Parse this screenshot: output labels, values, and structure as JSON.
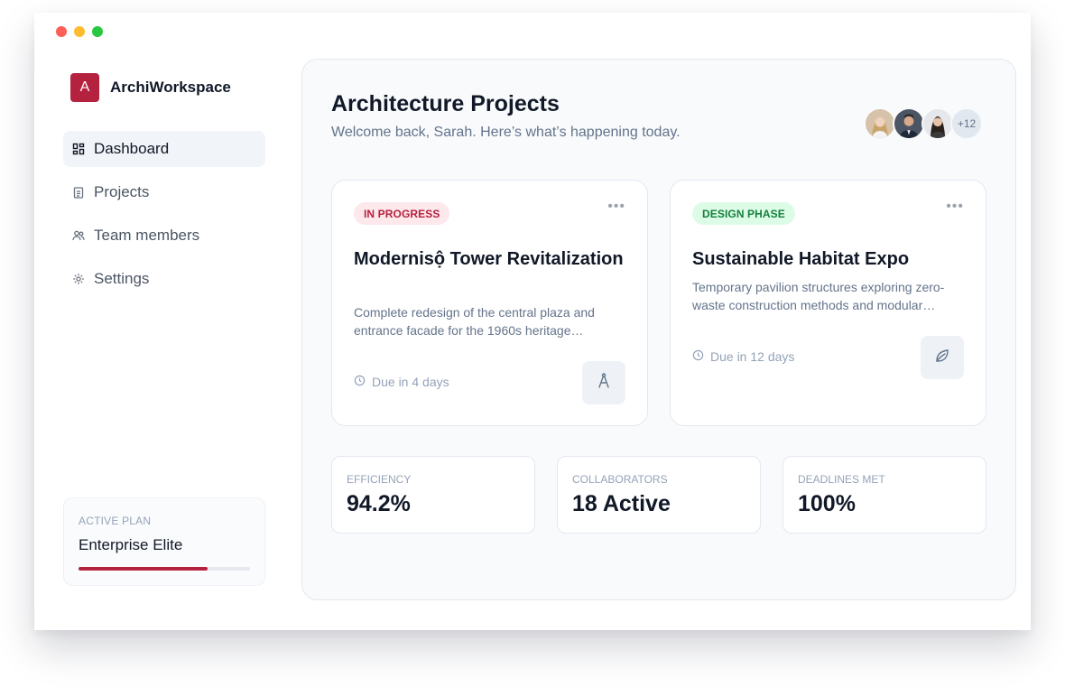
{
  "app": {
    "logo_letter": "A",
    "name": "ArchiWorkspace"
  },
  "sidebar": {
    "items": [
      {
        "label": "Dashboard",
        "icon": "dashboard-icon",
        "active": true
      },
      {
        "label": "Projects",
        "icon": "clipboard-icon",
        "active": false
      },
      {
        "label": "Team members",
        "icon": "users-icon",
        "active": false
      },
      {
        "label": "Settings",
        "icon": "gear-icon",
        "active": false
      }
    ],
    "plan": {
      "label": "ACTIVE PLAN",
      "name": "Enterprise Elite",
      "progress_fraction": 0.75
    }
  },
  "header": {
    "title": "Architecture Projects",
    "subtitle": "Welcome back, Sarah. Here’s what’s happening today.",
    "avatars_more": "+12"
  },
  "projects": [
    {
      "status": "IN PROGRESS",
      "title": "Modernisộ Tower Revitalization",
      "description": "Complete redesign of the central plaza and entrance facade for the 1960s heritage…",
      "due": "Due in 4 days",
      "icon": "compass-icon"
    },
    {
      "status": "DESIGN PHASE",
      "title": "Sustainable Habitat Expo",
      "description": "Temporary pavilion structures exploring zero-waste construction methods and modular…",
      "due": "Due in 12 days",
      "icon": "leaf-icon"
    }
  ],
  "stats": [
    {
      "label": "EFFICIENCY",
      "value": "94.2%"
    },
    {
      "label": "COLLABORATORS",
      "value": "18 Active"
    },
    {
      "label": "DEADLINES MET",
      "value": "100%"
    }
  ],
  "colors": {
    "accent": "#b5223f",
    "success": "#15803d"
  }
}
